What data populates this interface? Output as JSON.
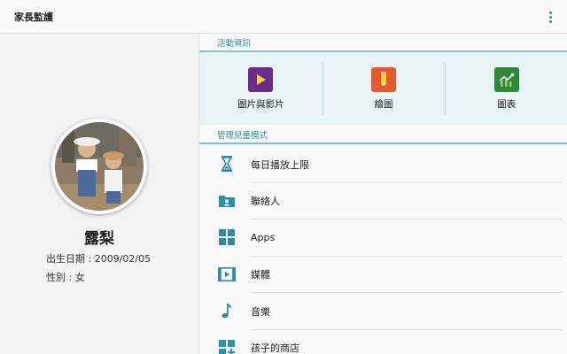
{
  "app": {
    "title": "家長監護"
  },
  "profile": {
    "name": "露梨",
    "birth_label": "出生日期 : 2009/02/05",
    "gender_label": "性別 : 女"
  },
  "activity": {
    "header": "活動資訊",
    "items": [
      {
        "label": "圖片與影片",
        "icon": "play-icon",
        "color": "#6a2d8c"
      },
      {
        "label": "繪圖",
        "icon": "pencil-icon",
        "color": "#e85a2c"
      },
      {
        "label": "圖表",
        "icon": "line-chart-icon",
        "color": "#2e8a3a"
      }
    ]
  },
  "manage": {
    "header": "管理兒童模式",
    "items": [
      {
        "label": "每日播放上限",
        "icon": "hourglass-icon"
      },
      {
        "label": "聯絡人",
        "icon": "contacts-folder-icon"
      },
      {
        "label": "Apps",
        "icon": "apps-grid-icon"
      },
      {
        "label": "媒體",
        "icon": "media-film-icon"
      },
      {
        "label": "音樂",
        "icon": "music-note-icon"
      },
      {
        "label": "孩子的商店",
        "icon": "store-grid-add-icon"
      }
    ]
  },
  "colors": {
    "accent": "#2a8fa8",
    "panel": "#e7f3f7"
  }
}
